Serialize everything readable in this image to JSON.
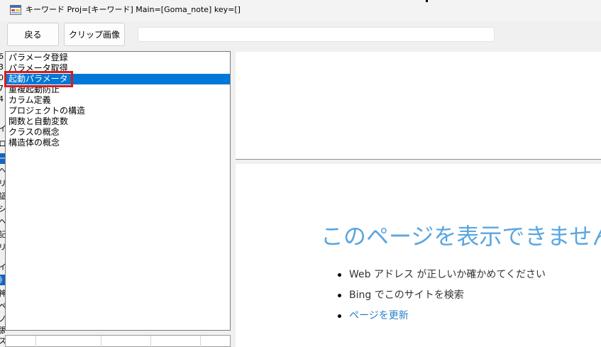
{
  "window": {
    "title": "キーワード  Proj=[キーワード]  Main=[Goma_note]  key=[]",
    "icon": "form-app-icon"
  },
  "toolbar": {
    "back_label": "戻る",
    "clip_image_label": "クリップ画像",
    "text_value": ""
  },
  "left_strip": {
    "fragments": [
      "6",
      "3",
      "0",
      "7",
      "4",
      "イ",
      "ロ",
      "一",
      "ヘ",
      "リ",
      "証",
      "シ",
      "ヘ",
      "記",
      "リ",
      "イ",
      "》",
      "神",
      "ペ",
      "ノ",
      "張",
      "ス"
    ]
  },
  "list": {
    "items": [
      "パラメータ登録",
      "パラメータ取得",
      "起動パラメータ",
      "重複起動防止",
      "カラム定義",
      "プロジェクトの構造",
      "関数と自動変数",
      "クラスの概念",
      "構造体の概念"
    ],
    "selected_index": 2
  },
  "browser": {
    "heading": "このページを表示できません",
    "bullets": [
      "Web アドレス が正しいか確かめてください",
      "Bing でこのサイトを検索"
    ],
    "refresh_link": "ページを更新"
  },
  "colors": {
    "selection": "#0078d7",
    "highlight_box": "#d81b1b",
    "heading": "#5aa6e0",
    "link": "#2b7fc9"
  }
}
